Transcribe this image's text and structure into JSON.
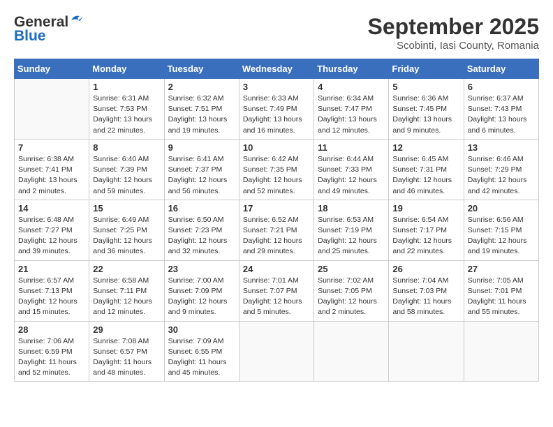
{
  "header": {
    "logo_line1": "General",
    "logo_line2": "Blue",
    "month": "September 2025",
    "location": "Scobinti, Iasi County, Romania"
  },
  "weekdays": [
    "Sunday",
    "Monday",
    "Tuesday",
    "Wednesday",
    "Thursday",
    "Friday",
    "Saturday"
  ],
  "weeks": [
    [
      {
        "day": "",
        "info": ""
      },
      {
        "day": "1",
        "info": "Sunrise: 6:31 AM\nSunset: 7:53 PM\nDaylight: 13 hours\nand 22 minutes."
      },
      {
        "day": "2",
        "info": "Sunrise: 6:32 AM\nSunset: 7:51 PM\nDaylight: 13 hours\nand 19 minutes."
      },
      {
        "day": "3",
        "info": "Sunrise: 6:33 AM\nSunset: 7:49 PM\nDaylight: 13 hours\nand 16 minutes."
      },
      {
        "day": "4",
        "info": "Sunrise: 6:34 AM\nSunset: 7:47 PM\nDaylight: 13 hours\nand 12 minutes."
      },
      {
        "day": "5",
        "info": "Sunrise: 6:36 AM\nSunset: 7:45 PM\nDaylight: 13 hours\nand 9 minutes."
      },
      {
        "day": "6",
        "info": "Sunrise: 6:37 AM\nSunset: 7:43 PM\nDaylight: 13 hours\nand 6 minutes."
      }
    ],
    [
      {
        "day": "7",
        "info": "Sunrise: 6:38 AM\nSunset: 7:41 PM\nDaylight: 13 hours\nand 2 minutes."
      },
      {
        "day": "8",
        "info": "Sunrise: 6:40 AM\nSunset: 7:39 PM\nDaylight: 12 hours\nand 59 minutes."
      },
      {
        "day": "9",
        "info": "Sunrise: 6:41 AM\nSunset: 7:37 PM\nDaylight: 12 hours\nand 56 minutes."
      },
      {
        "day": "10",
        "info": "Sunrise: 6:42 AM\nSunset: 7:35 PM\nDaylight: 12 hours\nand 52 minutes."
      },
      {
        "day": "11",
        "info": "Sunrise: 6:44 AM\nSunset: 7:33 PM\nDaylight: 12 hours\nand 49 minutes."
      },
      {
        "day": "12",
        "info": "Sunrise: 6:45 AM\nSunset: 7:31 PM\nDaylight: 12 hours\nand 46 minutes."
      },
      {
        "day": "13",
        "info": "Sunrise: 6:46 AM\nSunset: 7:29 PM\nDaylight: 12 hours\nand 42 minutes."
      }
    ],
    [
      {
        "day": "14",
        "info": "Sunrise: 6:48 AM\nSunset: 7:27 PM\nDaylight: 12 hours\nand 39 minutes."
      },
      {
        "day": "15",
        "info": "Sunrise: 6:49 AM\nSunset: 7:25 PM\nDaylight: 12 hours\nand 36 minutes."
      },
      {
        "day": "16",
        "info": "Sunrise: 6:50 AM\nSunset: 7:23 PM\nDaylight: 12 hours\nand 32 minutes."
      },
      {
        "day": "17",
        "info": "Sunrise: 6:52 AM\nSunset: 7:21 PM\nDaylight: 12 hours\nand 29 minutes."
      },
      {
        "day": "18",
        "info": "Sunrise: 6:53 AM\nSunset: 7:19 PM\nDaylight: 12 hours\nand 25 minutes."
      },
      {
        "day": "19",
        "info": "Sunrise: 6:54 AM\nSunset: 7:17 PM\nDaylight: 12 hours\nand 22 minutes."
      },
      {
        "day": "20",
        "info": "Sunrise: 6:56 AM\nSunset: 7:15 PM\nDaylight: 12 hours\nand 19 minutes."
      }
    ],
    [
      {
        "day": "21",
        "info": "Sunrise: 6:57 AM\nSunset: 7:13 PM\nDaylight: 12 hours\nand 15 minutes."
      },
      {
        "day": "22",
        "info": "Sunrise: 6:58 AM\nSunset: 7:11 PM\nDaylight: 12 hours\nand 12 minutes."
      },
      {
        "day": "23",
        "info": "Sunrise: 7:00 AM\nSunset: 7:09 PM\nDaylight: 12 hours\nand 9 minutes."
      },
      {
        "day": "24",
        "info": "Sunrise: 7:01 AM\nSunset: 7:07 PM\nDaylight: 12 hours\nand 5 minutes."
      },
      {
        "day": "25",
        "info": "Sunrise: 7:02 AM\nSunset: 7:05 PM\nDaylight: 12 hours\nand 2 minutes."
      },
      {
        "day": "26",
        "info": "Sunrise: 7:04 AM\nSunset: 7:03 PM\nDaylight: 11 hours\nand 58 minutes."
      },
      {
        "day": "27",
        "info": "Sunrise: 7:05 AM\nSunset: 7:01 PM\nDaylight: 11 hours\nand 55 minutes."
      }
    ],
    [
      {
        "day": "28",
        "info": "Sunrise: 7:06 AM\nSunset: 6:59 PM\nDaylight: 11 hours\nand 52 minutes."
      },
      {
        "day": "29",
        "info": "Sunrise: 7:08 AM\nSunset: 6:57 PM\nDaylight: 11 hours\nand 48 minutes."
      },
      {
        "day": "30",
        "info": "Sunrise: 7:09 AM\nSunset: 6:55 PM\nDaylight: 11 hours\nand 45 minutes."
      },
      {
        "day": "",
        "info": ""
      },
      {
        "day": "",
        "info": ""
      },
      {
        "day": "",
        "info": ""
      },
      {
        "day": "",
        "info": ""
      }
    ]
  ]
}
